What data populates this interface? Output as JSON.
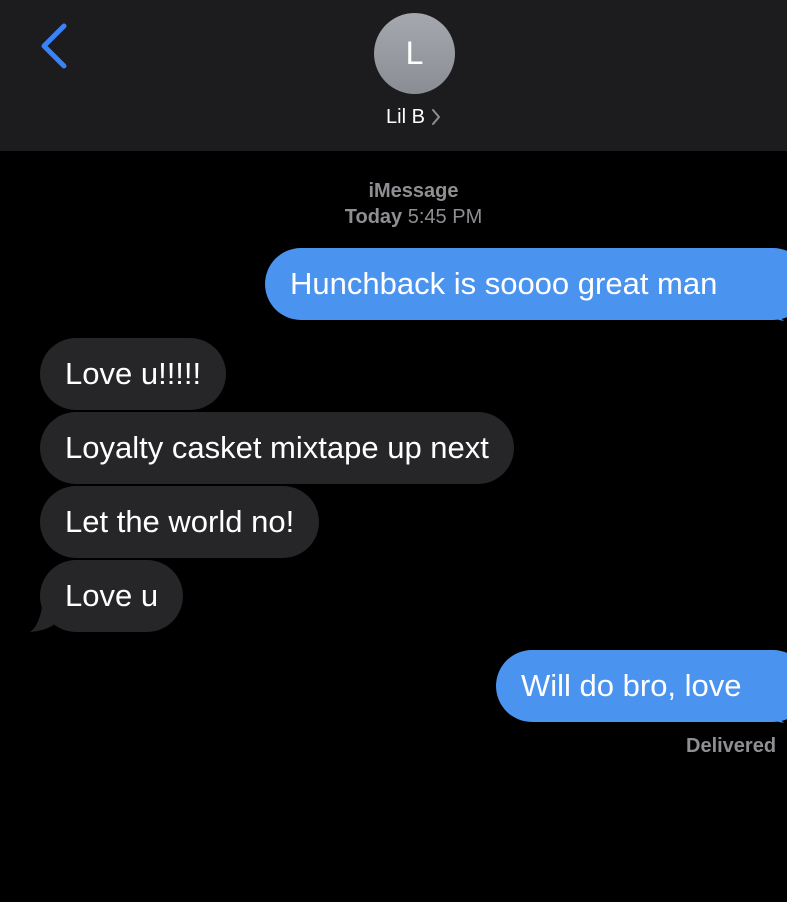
{
  "header": {
    "contact_initial": "L",
    "contact_name": "Lil B",
    "accent_color": "#3a82f7",
    "icons": [
      "chevron-left-icon",
      "chevron-right-icon"
    ]
  },
  "conversation": {
    "service": "iMessage",
    "day": "Today",
    "time": "5:45 PM",
    "messages": [
      {
        "direction": "outgoing",
        "text": "Hunchback is soooo great man"
      },
      {
        "direction": "incoming",
        "text": "Love u!!!!!"
      },
      {
        "direction": "incoming",
        "text": "Loyalty casket mixtape up next"
      },
      {
        "direction": "incoming",
        "text": "Let the world no!"
      },
      {
        "direction": "incoming",
        "text": "Love u"
      },
      {
        "direction": "outgoing",
        "text": "Will do bro, love"
      }
    ],
    "delivery_status": "Delivered"
  },
  "colors": {
    "background": "#000000",
    "header_bg": "#1c1c1e",
    "outgoing_bubble": "#4a94f0",
    "incoming_bubble": "#262628",
    "meta_text": "#8e8e93"
  }
}
